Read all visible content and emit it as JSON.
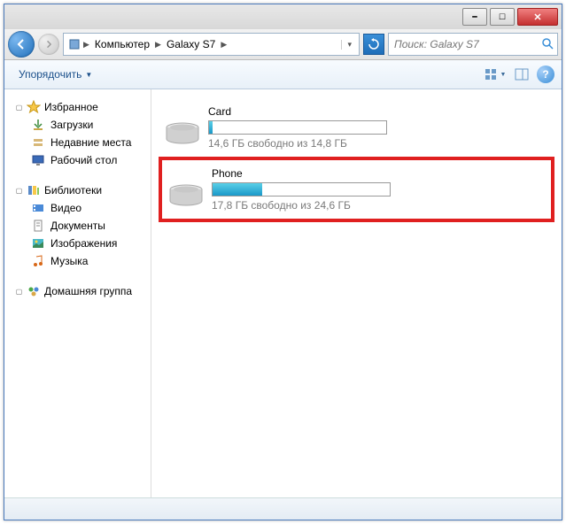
{
  "breadcrumb": {
    "seg1": "Компьютер",
    "seg2": "Galaxy S7"
  },
  "search": {
    "placeholder": "Поиск: Galaxy S7"
  },
  "toolbar": {
    "organize": "Упорядочить"
  },
  "sidebar": {
    "favorites": {
      "label": "Избранное",
      "items": [
        "Загрузки",
        "Недавние места",
        "Рабочий стол"
      ]
    },
    "libraries": {
      "label": "Библиотеки",
      "items": [
        "Видео",
        "Документы",
        "Изображения",
        "Музыка"
      ]
    },
    "homegroup": {
      "label": "Домашняя группа"
    }
  },
  "drives": [
    {
      "name": "Card",
      "fill_pct": 2,
      "status": "14,6 ГБ свободно из 14,8 ГБ",
      "highlight": false
    },
    {
      "name": "Phone",
      "fill_pct": 28,
      "status": "17,8 ГБ свободно из 24,6 ГБ",
      "highlight": true
    }
  ]
}
